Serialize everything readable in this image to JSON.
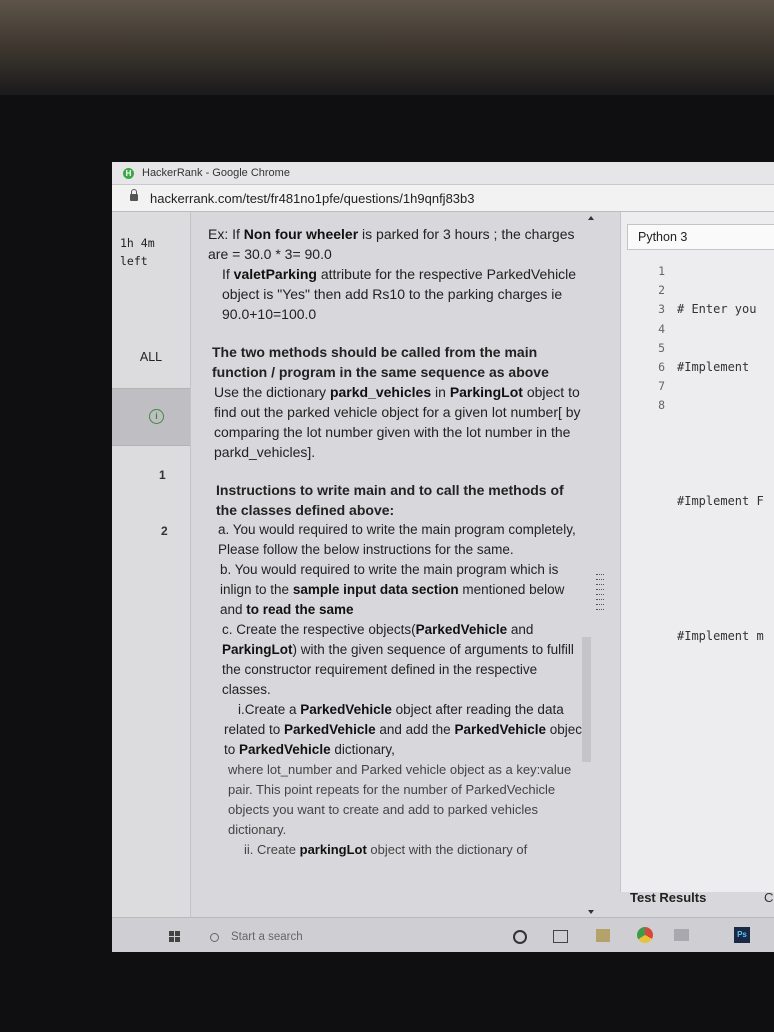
{
  "window": {
    "title": "HackerRank - Google Chrome",
    "app_icon": "H"
  },
  "address_bar": {
    "url": "hackerrank.com/test/fr481no1pfe/questions/1h9qnfj83b3"
  },
  "sidebar": {
    "timer_line1": "1h 4m",
    "timer_line2": "left",
    "all_label": "ALL",
    "question_numbers": [
      "1",
      "2"
    ]
  },
  "question": {
    "p1": [
      "Ex: If ",
      "Non four wheeler",
      " is parked for 3 hours ;  the charges are = 30.0 * 3= 90.0"
    ],
    "p2": [
      "If ",
      "valetParking",
      " attribute for the respective ParkedVehicle object is \"Yes\" then add Rs10 to the parking charges  ie  90.0+10=100.0"
    ],
    "p3": "The two methods should be called from the main function / program in the same sequence as above",
    "p4": [
      "Use the dictionary ",
      "parkd_vehicles",
      " in ",
      "ParkingLot",
      " object to find out the parked vehicle object for a given lot number[ by comparing the lot number given with the lot number in the parkd_vehicles]."
    ],
    "p5": "Instructions to write main and to call the methods of the classes defined above:",
    "p6": "a. You would required to write the main program completely, Please follow the below instructions for the same.",
    "p7": [
      "b. You would required to write the main program which is inlign to the ",
      "sample input data section",
      " mentioned below and ",
      "to read the same"
    ],
    "p8": [
      "c. Create the respective objects(",
      "ParkedVehicle",
      " and ",
      "ParkingLot",
      ") with the given sequence of arguments to fulfill the constructor requirement defined in the respective classes."
    ],
    "p9": [
      "i.Create a ",
      "ParkedVehicle",
      " object after reading the data related to ",
      "ParkedVehicle",
      " and add the ",
      "ParkedVehicle",
      " object to ",
      "ParkedVehicle",
      " dictionary,"
    ],
    "p10": "where lot_number and Parked vehicle object as a key:value pair. This point repeats for the number of ParkedVechicle objects you want to create and add to parked vehicles      dictionary.",
    "p11": [
      "ii. Create ",
      "parkingLot",
      " object with the dictionary of"
    ]
  },
  "editor": {
    "language": "Python 3",
    "line_numbers": [
      "1",
      "2",
      "3",
      "4",
      "5",
      "6",
      "7",
      "8"
    ],
    "lines": [
      "# Enter you",
      "#Implement ",
      "",
      "",
      "#Implement F",
      "",
      "",
      "#Implement m"
    ],
    "test_results_label": "Test Results",
    "test_results_extra": "C"
  },
  "taskbar": {
    "search_placeholder": "Start a search",
    "photoshop_label": "Ps"
  }
}
